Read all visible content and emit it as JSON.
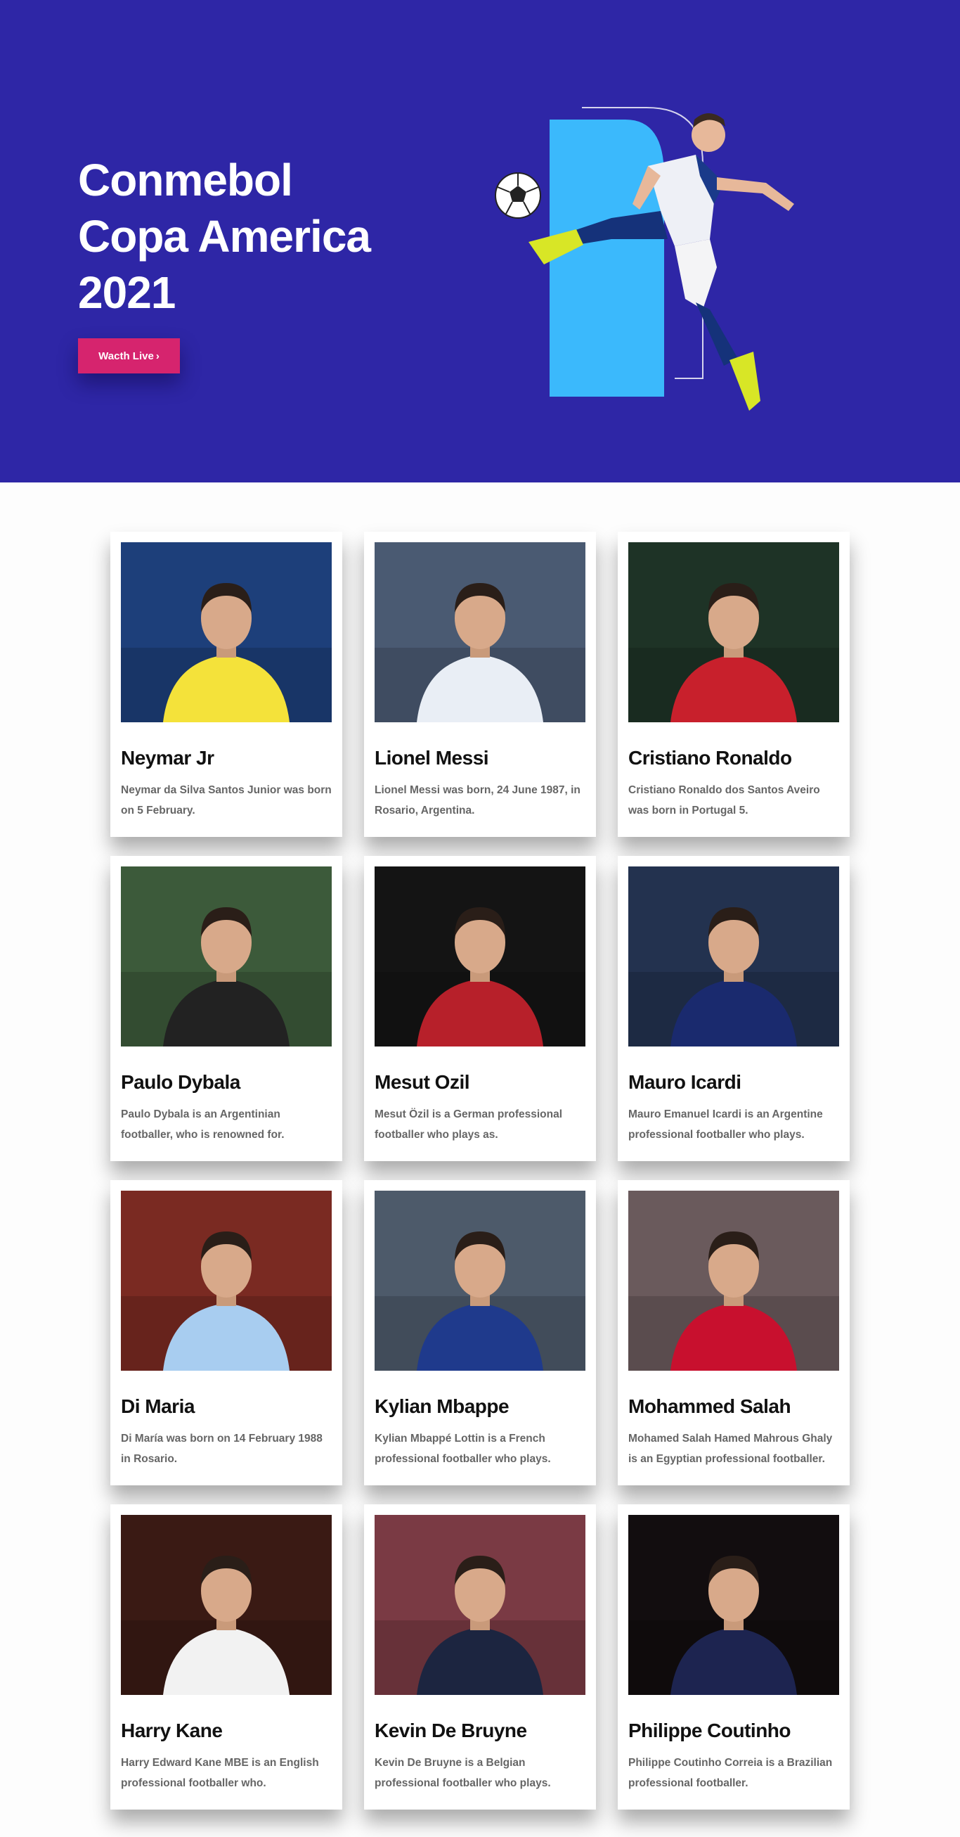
{
  "hero": {
    "title_lines": [
      "Conmebol",
      "Copa America",
      "2021"
    ],
    "cta_label": "Wacth Live",
    "cta_icon": "chevron-right-icon",
    "colors": {
      "background": "#2e26a6",
      "accent_block": "#3bb9fc",
      "cta": "#d6246e"
    }
  },
  "players": [
    {
      "name": "Neymar Jr",
      "bio": "Neymar da Silva Santos Junior was born on 5 February.",
      "kit": "#f4e23a",
      "backdrop": "#1d3f7a"
    },
    {
      "name": "Lionel Messi",
      "bio": "Lionel Messi was born, 24 June 1987, in Rosario, Argentina.",
      "kit": "#e9eef5",
      "backdrop": "#4a5a72"
    },
    {
      "name": "Cristiano Ronaldo",
      "bio": "Cristiano Ronaldo dos Santos Aveiro was born in Portugal 5.",
      "kit": "#c8202c",
      "backdrop": "#1e3326"
    },
    {
      "name": "Paulo Dybala",
      "bio": "Paulo Dybala is an Argentinian footballer, who is renowned for.",
      "kit": "#222222",
      "backdrop": "#3c5a3a"
    },
    {
      "name": "Mesut Ozil",
      "bio": "Mesut Özil is a German professional footballer who plays as.",
      "kit": "#b7202a",
      "backdrop": "#141414"
    },
    {
      "name": "Mauro Icardi",
      "bio": "Mauro Emanuel Icardi is an Argentine professional footballer who plays.",
      "kit": "#1a2a6e",
      "backdrop": "#23324f"
    },
    {
      "name": "Di Maria",
      "bio": "Di María was born on 14 February 1988 in Rosario.",
      "kit": "#a8cdf0",
      "backdrop": "#7a2a22"
    },
    {
      "name": "Kylian Mbappe",
      "bio": "Kylian Mbappé Lottin is a French professional footballer who plays.",
      "kit": "#1f3a8c",
      "backdrop": "#4d5a6a"
    },
    {
      "name": "Mohammed Salah",
      "bio": "Mohamed Salah Hamed Mahrous Ghaly is an Egyptian professional footballer.",
      "kit": "#c8102e",
      "backdrop": "#6a5a5c"
    },
    {
      "name": "Harry Kane",
      "bio": "Harry Edward Kane MBE is an English professional footballer who.",
      "kit": "#f2f2f2",
      "backdrop": "#3a1a14"
    },
    {
      "name": "Kevin De Bruyne",
      "bio": "Kevin De Bruyne is a Belgian professional footballer who plays.",
      "kit": "#1c2540",
      "backdrop": "#7a3a44"
    },
    {
      "name": "Philippe Coutinho",
      "bio": "Philippe Coutinho Correia is a Brazilian professional footballer.",
      "kit": "#1d2450",
      "backdrop": "#120d0f"
    }
  ]
}
